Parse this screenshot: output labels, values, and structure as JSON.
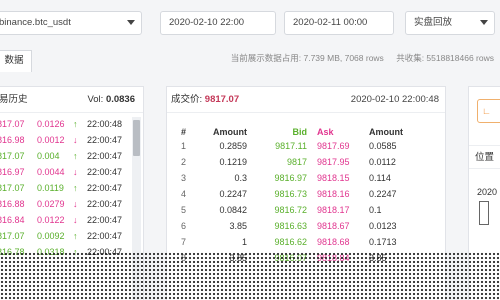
{
  "controls": {
    "symbol": "binance.btc_usdt",
    "start_time": "2020-02-10 22:00",
    "end_time": "2020-02-11 00:00",
    "mode": "实盘回放"
  },
  "tab": {
    "label": "数据"
  },
  "info": {
    "memory": "当前展示数据占用: 7.739 MB, 7068 rows",
    "total": "共收集: 5518818466 rows"
  },
  "trades": {
    "title": "易历史",
    "volume_label": "Vol:",
    "volume_value": "0.0836",
    "rows": [
      {
        "price": "817.07",
        "qty": "0.0126",
        "arrow": "↑",
        "time": "22:00:48",
        "color": "pink"
      },
      {
        "price": "816.98",
        "qty": "0.0012",
        "arrow": "↓",
        "time": "22:00:47",
        "color": "pink"
      },
      {
        "price": "817.07",
        "qty": "0.004",
        "arrow": "↑",
        "time": "22:00:47",
        "color": "green"
      },
      {
        "price": "816.97",
        "qty": "0.0044",
        "arrow": "↓",
        "time": "22:00:47",
        "color": "pink"
      },
      {
        "price": "817.07",
        "qty": "0.0119",
        "arrow": "↑",
        "time": "22:00:47",
        "color": "green"
      },
      {
        "price": "816.88",
        "qty": "0.0279",
        "arrow": "↓",
        "time": "22:00:47",
        "color": "pink"
      },
      {
        "price": "816.84",
        "qty": "0.0122",
        "arrow": "↓",
        "time": "22:00:47",
        "color": "pink"
      },
      {
        "price": "817.07",
        "qty": "0.0092",
        "arrow": "↑",
        "time": "22:00:47",
        "color": "green"
      },
      {
        "price": "816.78",
        "qty": "0.0318",
        "arrow": "↑",
        "time": "22:00:47",
        "color": "green"
      }
    ]
  },
  "orderbook": {
    "title_label": "成交价:",
    "title_value": "9817.07",
    "datetime": "2020-02-10 22:00:48",
    "headers": {
      "idx": "#",
      "amount": "Amount",
      "bid": "Bid",
      "ask": "Ask",
      "amount2": "Amount"
    },
    "rows": [
      {
        "idx": "1",
        "amount": "0.2859",
        "bid": "9817.11",
        "ask": "9817.69",
        "amount2": "0.0585"
      },
      {
        "idx": "2",
        "amount": "0.1219",
        "bid": "9817",
        "ask": "9817.95",
        "amount2": "0.0112"
      },
      {
        "idx": "3",
        "amount": "0.3",
        "bid": "9816.97",
        "ask": "9818.15",
        "amount2": "0.114"
      },
      {
        "idx": "4",
        "amount": "0.2247",
        "bid": "9816.73",
        "ask": "9818.16",
        "amount2": "0.2247"
      },
      {
        "idx": "5",
        "amount": "0.0842",
        "bid": "9816.72",
        "ask": "9818.17",
        "amount2": "0.1"
      },
      {
        "idx": "6",
        "amount": "3.85",
        "bid": "9816.63",
        "ask": "9818.67",
        "amount2": "0.0123"
      },
      {
        "idx": "7",
        "amount": "1",
        "bid": "9816.62",
        "ask": "9818.68",
        "amount2": "0.1713"
      },
      {
        "idx": "8",
        "amount": "3.85",
        "bid": "9816.07",
        "ask": "9818.84",
        "amount2": "3.85"
      }
    ]
  },
  "right": {
    "button": "∟",
    "position_label": "位置",
    "year": "2020"
  },
  "colors": {
    "pink": "#e1358f",
    "green": "#5ab02c",
    "price": "#c43858",
    "accent": "#f08a2a"
  }
}
